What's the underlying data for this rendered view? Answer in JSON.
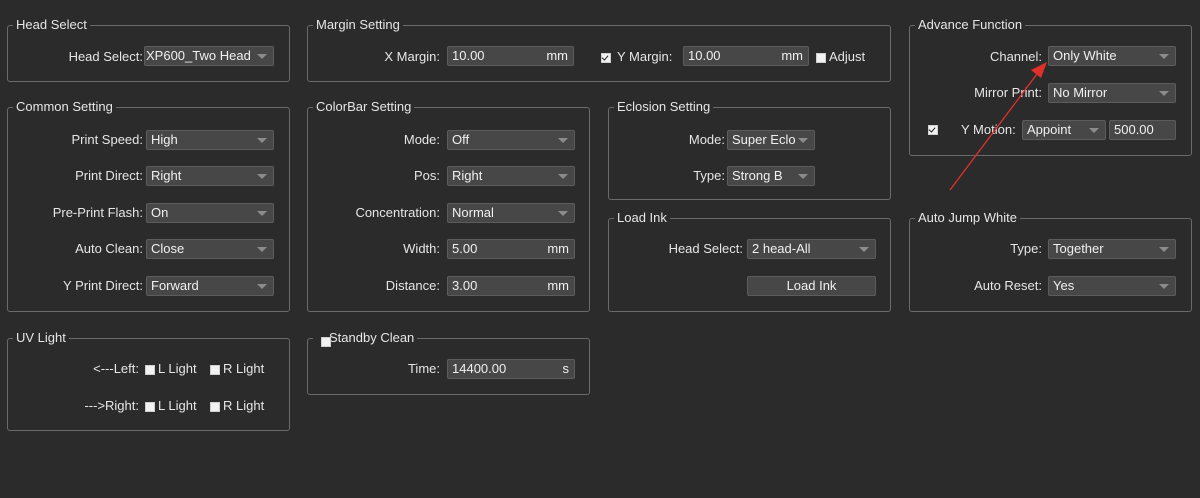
{
  "head_select": {
    "title": "Head Select",
    "label": "Head Select:",
    "value": "XP600_Two Head..."
  },
  "margin_setting": {
    "title": "Margin Setting",
    "x_label": "X Margin:",
    "x_value": "10.00",
    "x_unit": "mm",
    "y_label": "Y Margin:",
    "y_value": "10.00",
    "y_unit": "mm",
    "y_checked": true,
    "adjust_label": "Adjust",
    "adjust_checked": false
  },
  "advance_function": {
    "title": "Advance Function",
    "channel_label": "Channel:",
    "channel_value": "Only White",
    "mirror_label": "Mirror Print:",
    "mirror_value": "No Mirror",
    "ymotion_label": "Y Motion:",
    "ymotion_checked": true,
    "ymotion_value": "Appoint",
    "ymotion_number": "500.00"
  },
  "common_setting": {
    "title": "Common Setting",
    "rows": [
      {
        "label": "Print Speed:",
        "value": "High"
      },
      {
        "label": "Print Direct:",
        "value": "Right"
      },
      {
        "label": "Pre-Print Flash:",
        "value": "On"
      },
      {
        "label": "Auto Clean:",
        "value": "Close"
      },
      {
        "label": "Y Print Direct:",
        "value": "Forward"
      }
    ]
  },
  "colorbar_setting": {
    "title": "ColorBar Setting",
    "mode_label": "Mode:",
    "mode_value": "Off",
    "pos_label": "Pos:",
    "pos_value": "Right",
    "conc_label": "Concentration:",
    "conc_value": "Normal",
    "width_label": "Width:",
    "width_value": "5.00",
    "width_unit": "mm",
    "distance_label": "Distance:",
    "distance_value": "3.00",
    "distance_unit": "mm"
  },
  "eclosion_setting": {
    "title": "Eclosion Setting",
    "mode_label": "Mode:",
    "mode_value": "Super Eclos",
    "type_label": "Type:",
    "type_value": "Strong B"
  },
  "load_ink": {
    "title": "Load Ink",
    "head_label": "Head Select:",
    "head_value": "2 head-All",
    "button_label": "Load Ink"
  },
  "auto_jump_white": {
    "title": "Auto Jump White",
    "type_label": "Type:",
    "type_value": "Together",
    "reset_label": "Auto Reset:",
    "reset_value": "Yes"
  },
  "uv_light": {
    "title": "UV Light",
    "left_label": "<---Left:",
    "right_label": "--->Right:",
    "l_light": "L Light",
    "r_light": "R Light"
  },
  "standby_clean": {
    "title": "Standby Clean",
    "checked": false,
    "time_label": "Time:",
    "time_value": "14400.00",
    "time_unit": "s"
  },
  "colors": {
    "background": "#2b2b2b",
    "annotation_arrow": "#e0302a"
  }
}
